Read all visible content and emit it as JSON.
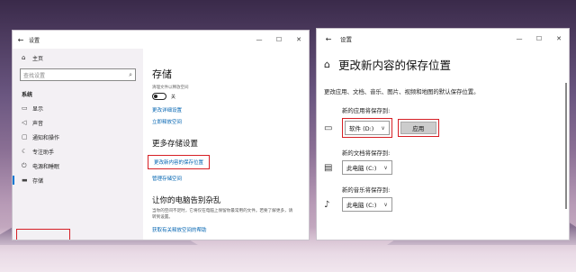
{
  "window1": {
    "title": "设置",
    "sidebar": {
      "home": "主页",
      "search_placeholder": "查找设置",
      "section": "系统",
      "items": [
        {
          "icon": "monitor-icon",
          "label": "显示"
        },
        {
          "icon": "speaker-icon",
          "label": "声音"
        },
        {
          "icon": "notification-icon",
          "label": "通知和操作"
        },
        {
          "icon": "focus-icon",
          "label": "专注助手"
        },
        {
          "icon": "power-icon",
          "label": "电源和睡眠"
        },
        {
          "icon": "storage-icon",
          "label": "存储"
        }
      ],
      "active_index": 5
    },
    "main": {
      "title": "存储",
      "small_text": "清理文件以释放空间",
      "toggle_label": "关",
      "links": [
        "更改详细设置",
        "立即释放空间"
      ],
      "section_title": "更多存储设置",
      "highlight_link": "更改新内容的保存位置",
      "manage_link": "管理存储空间",
      "section2_title": "让你的电脑告别杂乱",
      "para": "当你的空间不足时，它将仅在电脑上保留你最常用的文件。若要了解更多，请转到设置。",
      "last_link": "获取有关释放空间的帮助"
    }
  },
  "window2": {
    "title": "设置",
    "heading": "更改新内容的保存位置",
    "desc": "更改应用、文档、音乐、图片、视频和地图的默认保存位置。",
    "rows": [
      {
        "label": "新的应用将保存到:",
        "value": "软件 (D:)",
        "icon": "monitor-icon",
        "show_apply": true
      },
      {
        "label": "新的文档将保存到:",
        "value": "此电脑 (C:)",
        "icon": "folder-icon",
        "show_apply": false
      },
      {
        "label": "新的音乐将保存到:",
        "value": "此电脑 (C:)",
        "icon": "music-icon",
        "show_apply": false
      }
    ],
    "apply_label": "应用"
  }
}
